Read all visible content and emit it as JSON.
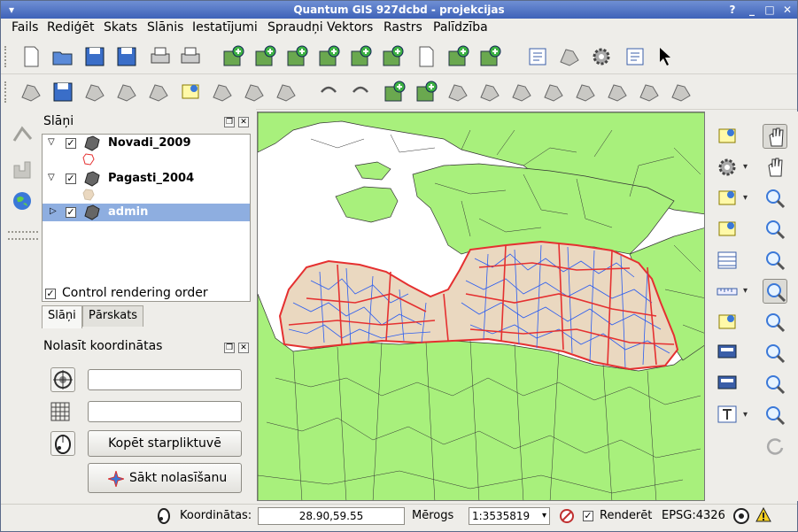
{
  "window": {
    "title": "Quantum GIS 927dcbd - projekcijas"
  },
  "menu": [
    "Fails",
    "Rediģēt",
    "Skats",
    "Slānis",
    "Iestatījumi",
    "Spraudņi",
    "Vektors",
    "Rastrs",
    "Palīdzība"
  ],
  "toolbar1": [
    "new-project-icon",
    "open-project-icon",
    "save-project-icon",
    "save-as-icon",
    "print-composer-icon",
    "print-icon",
    "add-vector-layer-icon",
    "add-raster-layer-icon",
    "add-postgis-layer-icon",
    "add-spatialite-layer-icon",
    "add-wms-layer-icon",
    "add-wfs-layer-icon",
    "new-shapefile-icon",
    "add-delimited-text-icon",
    "add-gpx-icon",
    "spell-abc-icon",
    "plugin-tag-icon",
    "plugin-tool-icon",
    "help-book-icon",
    "whats-this-icon"
  ],
  "toolbar2": [
    "edit-pencil-icon",
    "save-edits-icon",
    "capture-polygon-icon",
    "move-feature-icon",
    "node-tool-icon",
    "delete-selected-icon",
    "cut-icon",
    "copy-icon",
    "paste-icon",
    "undo-icon",
    "redo-icon",
    "add-ring-icon",
    "add-island-icon",
    "delete-ring-icon",
    "delete-part-icon",
    "reshape-icon",
    "split-icon",
    "merge-icon",
    "simplify-icon",
    "rotate-icon",
    "offset-icon"
  ],
  "layers_panel": {
    "title": "Slāņi",
    "layers": [
      {
        "name": "Novadi_2009",
        "checked": true,
        "expanded": true,
        "symbol_color": "#ffffff",
        "symbol_border": "#e53030"
      },
      {
        "name": "Pagasti_2004",
        "checked": true,
        "expanded": true,
        "symbol_color": "#ead8c0",
        "symbol_border": "#d0c0a8"
      },
      {
        "name": "admin",
        "checked": true,
        "expanded": false,
        "selected": true
      }
    ],
    "control_rendering_label": "Control rendering order",
    "control_rendering_checked": true,
    "tabs": [
      "Slāņi",
      "Pārskats"
    ],
    "active_tab": "Slāņi"
  },
  "coord_panel": {
    "title": "Nolasīt koordinātas",
    "field1_value": "",
    "field2_value": "",
    "copy_button": "Kopēt starpliktuvē",
    "start_button": "Sākt nolasīšanu"
  },
  "right_tools": [
    "identify-icon",
    "pan-icon",
    "settings-gear-icon",
    "pan-to-selected-icon",
    "select-icon",
    "zoom-in-icon",
    "deselect-icon",
    "zoom-out-icon",
    "attribute-table-icon",
    "zoom-full-icon",
    "measure-icon",
    "zoom-to-selection-icon",
    "map-tips-icon",
    "zoom-to-layer-icon",
    "new-bookmark-icon",
    "zoom-actual-icon",
    "show-bookmarks-icon",
    "zoom-last-icon",
    "text-annotation-icon",
    "zoom-next-icon",
    "refresh-icon"
  ],
  "status": {
    "coord_label": "Koordinātas:",
    "coord_value": "28.90,59.55",
    "scale_label": "Mērogs",
    "scale_value": "1:3535819",
    "render_label": "Renderēt",
    "render_checked": true,
    "epsg": "EPSG:4326"
  },
  "colors": {
    "land": "#a8f07c",
    "sea": "#ffffff",
    "latvia_fill": "#ead8c0",
    "novadi_border": "#e53030",
    "pagasti_border": "#2a5cf0",
    "selection": "#8eaee0"
  }
}
